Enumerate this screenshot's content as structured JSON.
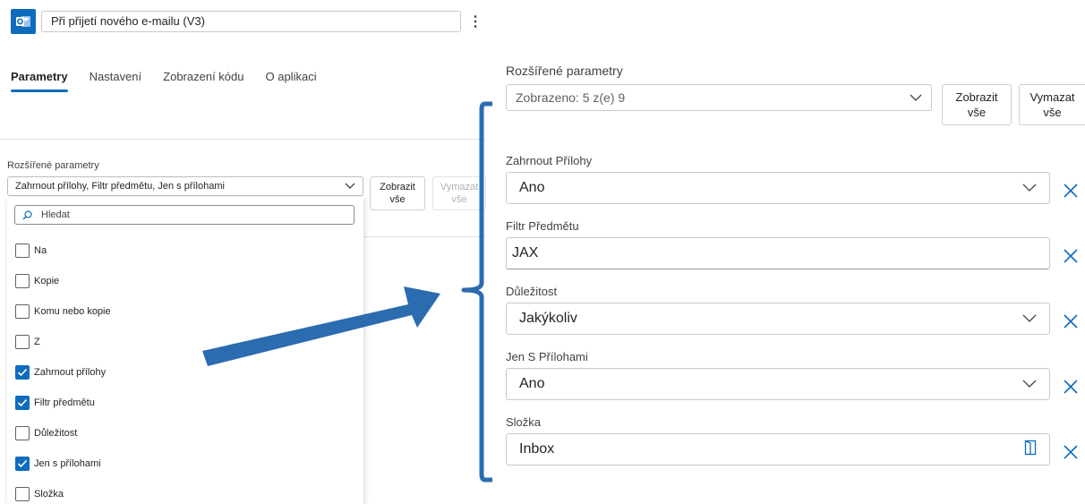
{
  "header": {
    "title": "Při přijetí nového e-mailu (V3)",
    "more_label": "⋮"
  },
  "tabs": [
    {
      "label": "Parametry",
      "active": true
    },
    {
      "label": "Nastavení",
      "active": false
    },
    {
      "label": "Zobrazení kódu",
      "active": false
    },
    {
      "label": "O aplikaci",
      "active": false
    }
  ],
  "left": {
    "adv_label": "Rozšířené parametry",
    "dropdown_value": "Zahrnout přílohy, Filtr předmětu, Jen s přílohami",
    "show_all_line1": "Zobrazit",
    "show_all_line2": "vše",
    "clear_all_line1": "Vymazat",
    "clear_all_line2": "vše",
    "search_placeholder": "Hledat",
    "options": [
      {
        "label": "Na",
        "checked": false
      },
      {
        "label": "Kopie",
        "checked": false
      },
      {
        "label": "Komu nebo kopie",
        "checked": false
      },
      {
        "label": "Z",
        "checked": false
      },
      {
        "label": "Zahrnout přílohy",
        "checked": true
      },
      {
        "label": "Filtr předmětu",
        "checked": true
      },
      {
        "label": "Důležitost",
        "checked": false
      },
      {
        "label": "Jen s přílohami",
        "checked": true
      },
      {
        "label": "Složka",
        "checked": false
      }
    ]
  },
  "right": {
    "adv_label": "Rozšířené parametry",
    "dropdown_value": "Zobrazeno: 5 z(e) 9",
    "show_all_line1": "Zobrazit",
    "show_all_line2": "vše",
    "clear_all_line1": "Vymazat",
    "clear_all_line2": "vše",
    "fields": [
      {
        "label": "Zahrnout Přílohy",
        "value": "Ano",
        "kind": "dropdown"
      },
      {
        "label": "Filtr Předmětu",
        "value": "JAX",
        "kind": "text"
      },
      {
        "label": "Důležitost",
        "value": "Jakýkoliv",
        "kind": "dropdown"
      },
      {
        "label": "Jen S Přílohami",
        "value": "Ano",
        "kind": "dropdown"
      },
      {
        "label": "Složka",
        "value": "Inbox",
        "kind": "folder"
      }
    ]
  },
  "colors": {
    "accent": "#0f6cbd",
    "annotation_blue": "#2b6cb0"
  }
}
